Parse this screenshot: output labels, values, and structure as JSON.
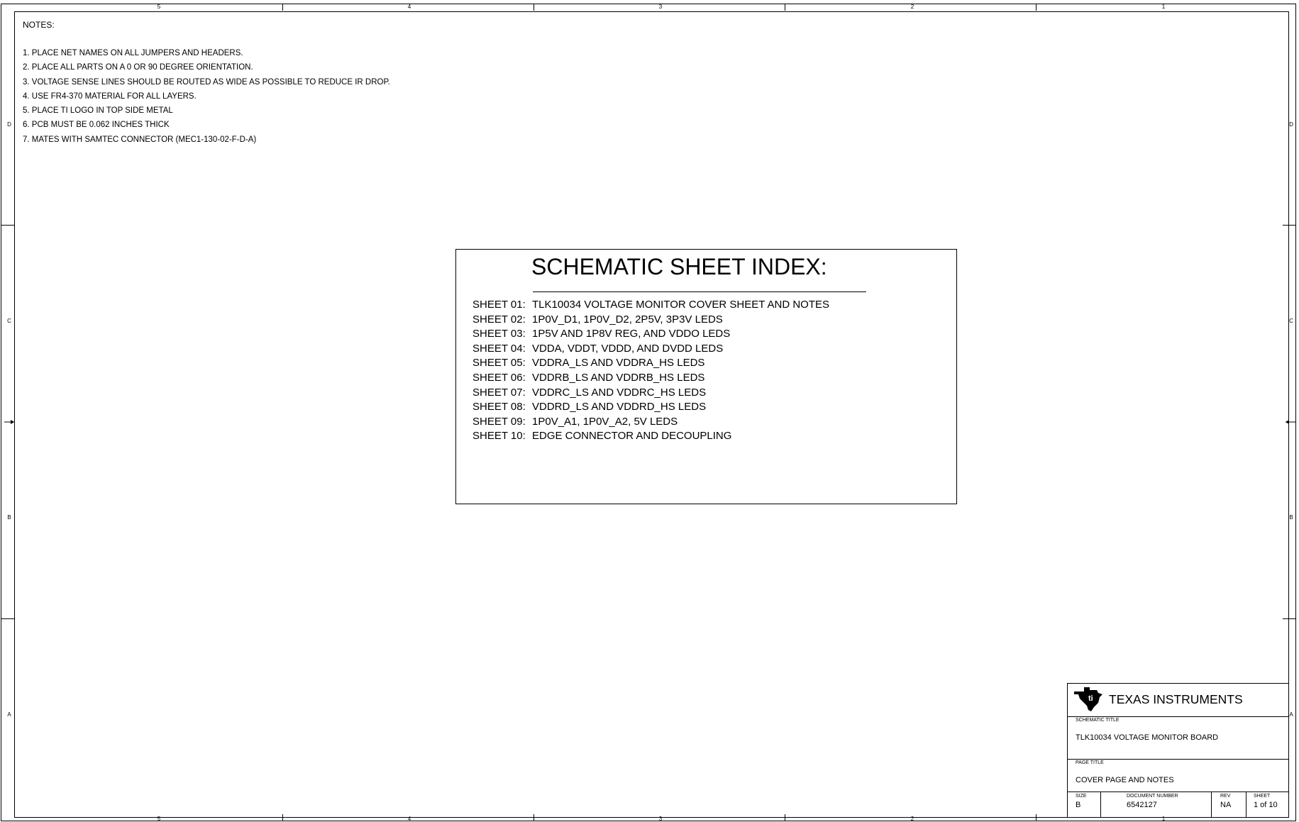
{
  "border": {
    "column_labels": [
      "5",
      "4",
      "3",
      "2",
      "1"
    ],
    "row_labels": [
      "D",
      "C",
      "B",
      "A"
    ]
  },
  "notes": {
    "title": "NOTES:",
    "items": [
      "1.  PLACE NET NAMES ON ALL JUMPERS AND HEADERS.",
      "2.  PLACE ALL PARTS ON A 0 OR 90 DEGREE ORIENTATION.",
      "3.  VOLTAGE SENSE LINES SHOULD BE ROUTED AS WIDE AS POSSIBLE TO REDUCE IR DROP.",
      "4.  USE FR4-370 MATERIAL FOR ALL LAYERS.",
      "5.  PLACE TI LOGO IN TOP SIDE METAL",
      "6.  PCB MUST BE 0.062 INCHES THICK",
      "7.  MATES WITH SAMTEC CONNECTOR (MEC1-130-02-F-D-A)"
    ]
  },
  "sheet_index": {
    "title": "SCHEMATIC SHEET INDEX:",
    "sheets": [
      {
        "number": "SHEET 01:",
        "description": "TLK10034 VOLTAGE MONITOR COVER SHEET AND NOTES"
      },
      {
        "number": "SHEET 02:",
        "description": "1P0V_D1, 1P0V_D2, 2P5V, 3P3V LEDS"
      },
      {
        "number": "SHEET 03:",
        "description": "1P5V AND 1P8V REG, AND VDDO LEDS"
      },
      {
        "number": "SHEET 04:",
        "description": "VDDA, VDDT, VDDD, AND DVDD LEDS"
      },
      {
        "number": "SHEET 05:",
        "description": "VDDRA_LS AND VDDRA_HS LEDS"
      },
      {
        "number": "SHEET 06:",
        "description": "VDDRB_LS AND VDDRB_HS LEDS"
      },
      {
        "number": "SHEET 07:",
        "description": "VDDRC_LS AND VDDRC_HS LEDS"
      },
      {
        "number": "SHEET 08:",
        "description": "VDDRD_LS AND VDDRD_HS LEDS"
      },
      {
        "number": "SHEET 09:",
        "description": "1P0V_A1, 1P0V_A2, 5V LEDS"
      },
      {
        "number": "SHEET 10:",
        "description": "EDGE CONNECTOR AND DECOUPLING"
      }
    ]
  },
  "title_block": {
    "company": "TEXAS INSTRUMENTS",
    "logo_icon": "texas-instruments-logo",
    "schematic_title_label": "SCHEMATIC TITLE",
    "schematic_title": "TLK10034 VOLTAGE MONITOR BOARD",
    "page_title_label": "PAGE TITLE",
    "page_title": "COVER PAGE AND NOTES",
    "size_label": "SIZE",
    "size": "B",
    "document_number_label": "DOCUMENT NUMBER",
    "document_number": "6542127",
    "rev_label": "REV",
    "rev": "NA",
    "sheet_label": "SHEET",
    "sheet": "1 of 10"
  }
}
